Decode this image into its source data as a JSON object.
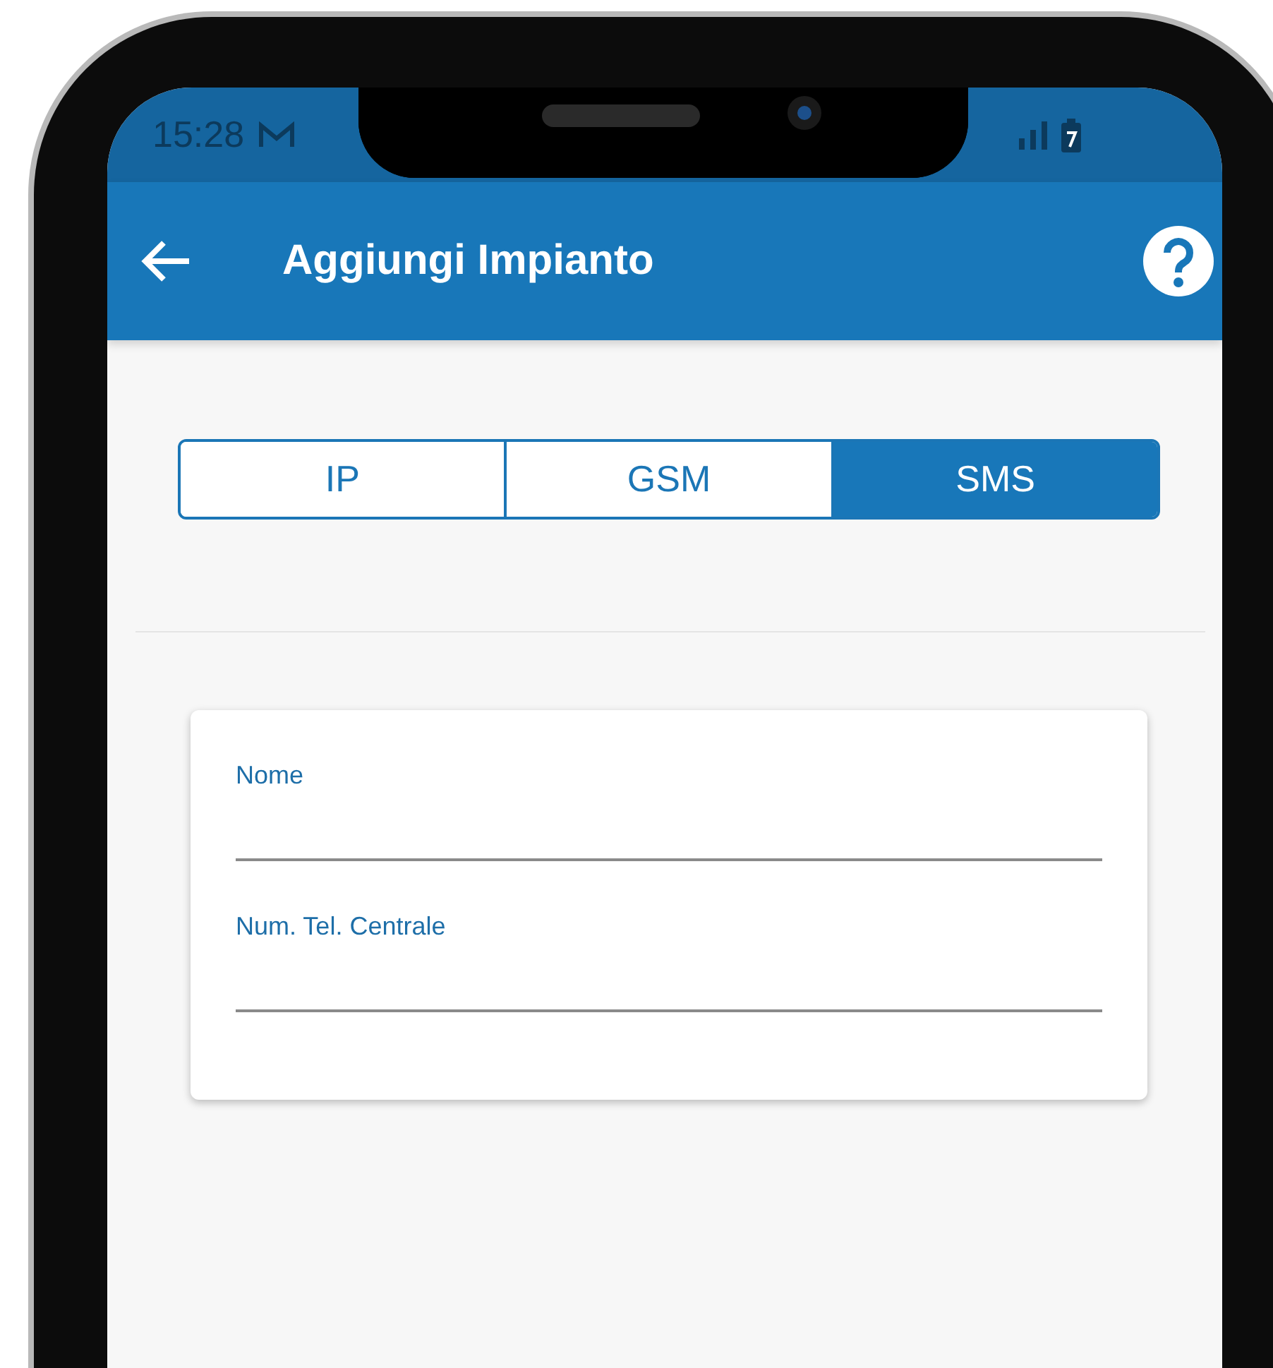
{
  "status_bar": {
    "time": "15:28"
  },
  "app_bar": {
    "title": "Aggiungi Impianto"
  },
  "tabs": [
    {
      "label": "IP",
      "selected": false
    },
    {
      "label": "GSM",
      "selected": false
    },
    {
      "label": "SMS",
      "selected": true
    }
  ],
  "form": {
    "fields": [
      {
        "label": "Nome"
      },
      {
        "label": "Num. Tel. Centrale"
      }
    ]
  }
}
